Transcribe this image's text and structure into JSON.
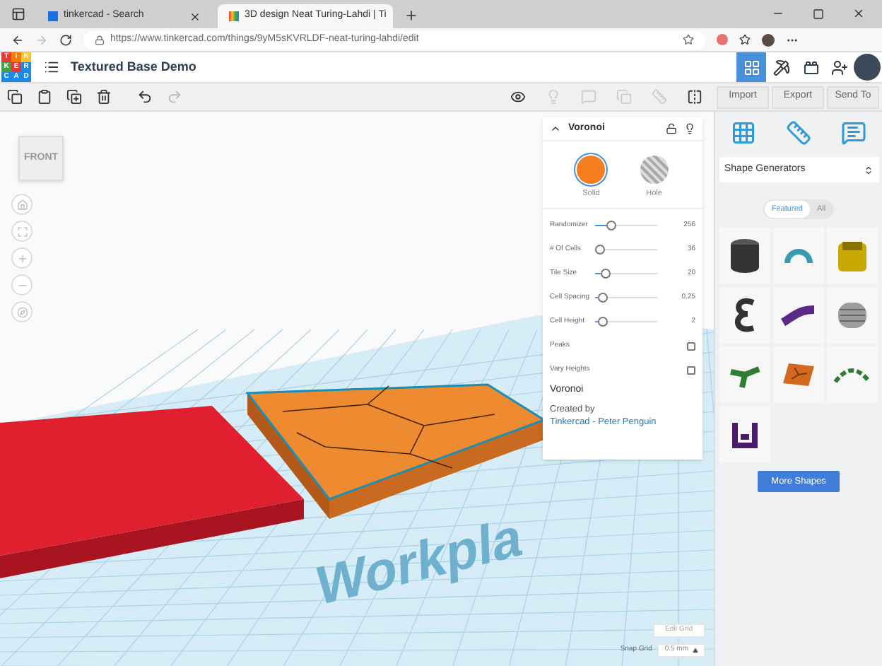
{
  "browser": {
    "tabs": [
      {
        "title": "tinkercad - Search",
        "selected": false
      },
      {
        "title": "3D design Neat Turing-Lahdi | Ti",
        "selected": true
      }
    ],
    "url": "https://www.tinkercad.com/things/9yM5sKVRLDF-neat-turing-lahdi/edit"
  },
  "header": {
    "logo_letters": [
      "T",
      "I",
      "N",
      "K",
      "E",
      "R",
      "C",
      "A",
      "D"
    ],
    "design_title": "Textured Base Demo"
  },
  "right_actions": [
    "Import",
    "Export",
    "Send To"
  ],
  "view_cube": {
    "label": "FRONT"
  },
  "workplane": {
    "label": "Workpla"
  },
  "inspector": {
    "title": "Voronoi",
    "modes": [
      {
        "label": "Solid",
        "kind": "solid",
        "selected": true
      },
      {
        "label": "Hole",
        "kind": "hole",
        "selected": false
      }
    ],
    "params": [
      {
        "label": "Randomizer",
        "value": "256",
        "level": 0.22
      },
      {
        "label": "# Of Cells",
        "value": "36",
        "level": 0.0
      },
      {
        "label": "Tile Size",
        "value": "20",
        "level": 0.1
      },
      {
        "label": "Cell Spacing",
        "value": "0.25",
        "level": 0.05
      },
      {
        "label": "Cell Height",
        "value": "2",
        "level": 0.05
      }
    ],
    "options": [
      {
        "label": "Peaks",
        "checked": false
      },
      {
        "label": "Vary Heights",
        "checked": false
      }
    ],
    "footer_title": "Voronoi",
    "credit_prefix": "Created by",
    "credit_link": "Tinkercad - Peter Penguin"
  },
  "library": {
    "dropdown": "Shape Generators",
    "filters": [
      {
        "label": "Featured",
        "selected": true
      },
      {
        "label": "All",
        "selected": false
      }
    ],
    "more_button": "More Shapes"
  },
  "grid_controls": {
    "edit_button": "Edit Grid",
    "snap_label": "Snap Grid",
    "snap_value": "0.5 mm"
  }
}
